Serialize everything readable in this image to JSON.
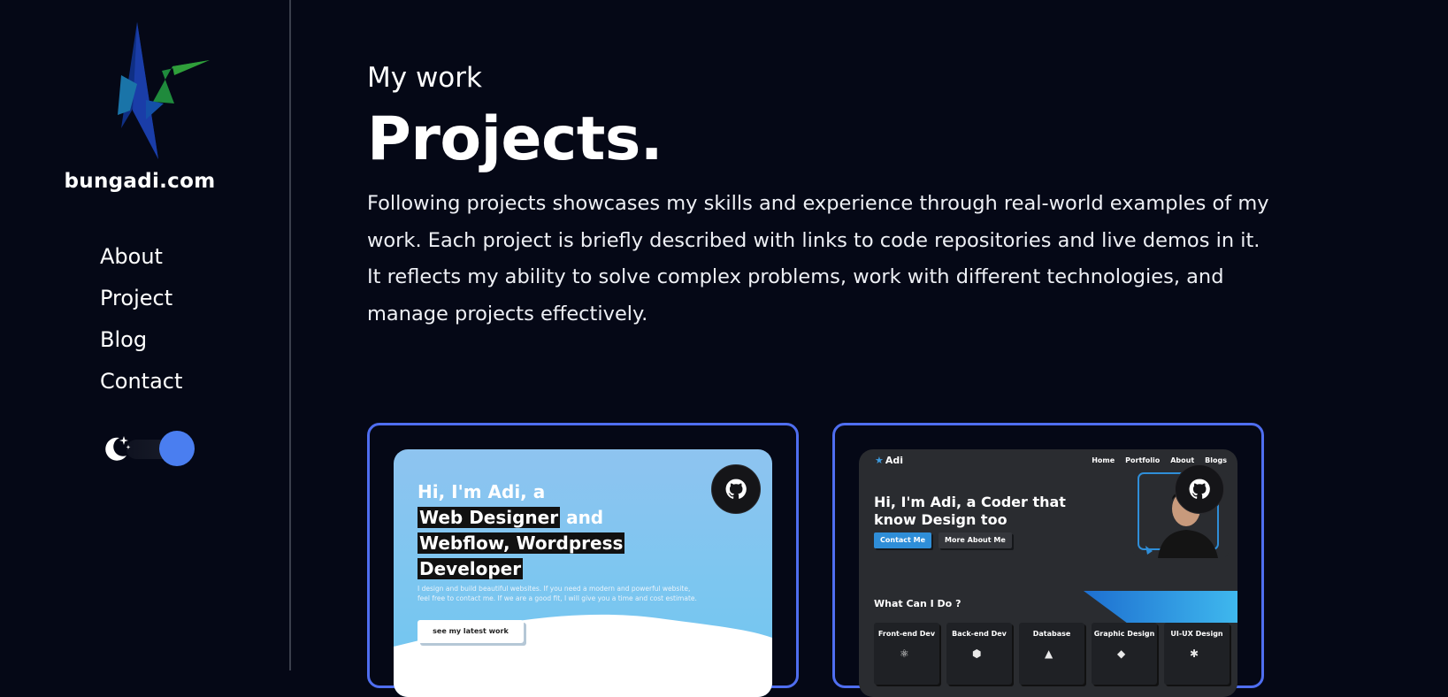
{
  "sidebar": {
    "brand": "bungadi.com",
    "nav": [
      "About",
      "Project",
      "Blog",
      "Contact"
    ],
    "theme_toggle": {
      "icon": "moon-stars-icon",
      "state": "dark"
    }
  },
  "header": {
    "eyebrow": "My work",
    "title": "Projects.",
    "description": "Following projects showcases my skills and experience through real-world examples of my work. Each project is briefly described with links to code repositories and live demos in it. It reflects my ability to solve complex problems, work with different technologies, and manage projects effectively."
  },
  "colors": {
    "background": "#050816",
    "accent": "#4f6ef0",
    "toggle_knob": "#4a7ef0"
  },
  "projects": [
    {
      "link_icon": "github-icon",
      "preview": {
        "headline_1": "Hi, I'm Adi, a",
        "headline_highlight_1": "Web Designer",
        "headline_2": " and",
        "headline_highlight_2": "Webflow, Wordpress",
        "headline_highlight_3": "Developer",
        "body": "I design and build beautiful websites. If you need a modern and powerful website, feel free to contact me. If we are a good fit, I will give you a time and cost estimate.",
        "button": "see my latest work"
      }
    },
    {
      "link_icon": "github-icon",
      "preview": {
        "brand": "Adi",
        "nav": [
          "Home",
          "Portfolio",
          "About",
          "Blogs"
        ],
        "headline": "Hi, I'm Adi, a Coder that know Design too",
        "buttons": [
          "Contact Me",
          "More About Me"
        ],
        "section_title": "What Can I Do ?",
        "skills": [
          "Front-end Dev",
          "Back-end Dev",
          "Database",
          "Graphic Design",
          "UI-UX Design"
        ]
      }
    }
  ]
}
